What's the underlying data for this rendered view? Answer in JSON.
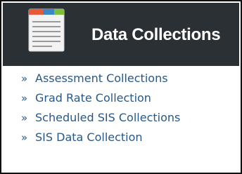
{
  "header": {
    "title": "Data Collections",
    "icon": "document-icon"
  },
  "links": {
    "bullet": "»",
    "items": [
      {
        "label": "Assessment Collections"
      },
      {
        "label": "Grad Rate Collection"
      },
      {
        "label": "Scheduled SIS Collections"
      },
      {
        "label": "SIS Data Collection"
      }
    ]
  },
  "colors": {
    "header_bg": "#2b3035",
    "header_text": "#ffffff",
    "link_text": "#2a5885",
    "icon_tab_orange": "#e8593a",
    "icon_tab_blue": "#3d86c6",
    "icon_tab_green": "#7bbf3a"
  }
}
